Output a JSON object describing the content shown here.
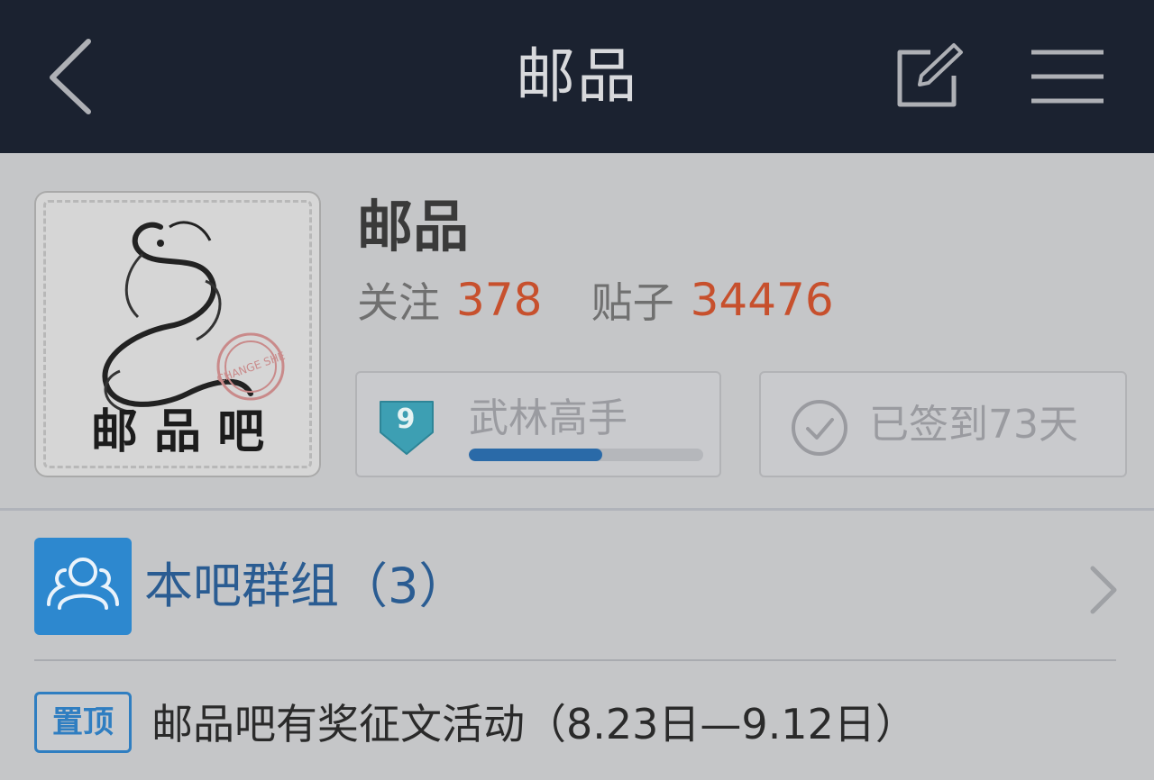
{
  "navbar": {
    "title": "邮品",
    "back_icon": "chevron-left-icon",
    "compose_icon": "compose-icon",
    "menu_icon": "hamburger-menu-icon"
  },
  "forum": {
    "name": "邮品",
    "avatar_text": "邮 品 吧",
    "stamp_text": "CHANGE SHE",
    "follow_label": "关注",
    "follow_count": "378",
    "posts_label": "贴子",
    "posts_count": "34476",
    "colors": {
      "count": "#c7502d",
      "accent": "#2d88cf"
    }
  },
  "level": {
    "number": "9",
    "title": "武林高手",
    "progress_fraction": 0.57
  },
  "signin": {
    "label": "已签到73天",
    "icon": "check-circle-icon"
  },
  "group": {
    "label": "本吧群组（3）",
    "icon": "group-people-icon"
  },
  "pinned": {
    "badge": "置顶",
    "title": "邮品吧有奖征文活动（8.23日—9.12日）"
  }
}
